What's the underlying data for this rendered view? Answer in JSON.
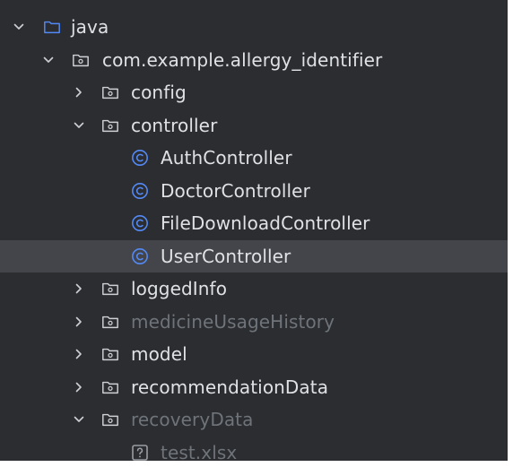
{
  "tree": {
    "items": [
      {
        "label": "java",
        "type": "source-folder",
        "state": "expanded"
      },
      {
        "label": "com.example.allergy_identifier",
        "type": "package",
        "state": "expanded"
      },
      {
        "label": "config",
        "type": "package",
        "state": "collapsed"
      },
      {
        "label": "controller",
        "type": "package",
        "state": "expanded"
      },
      {
        "label": "AuthController",
        "type": "class"
      },
      {
        "label": "DoctorController",
        "type": "class"
      },
      {
        "label": "FileDownloadController",
        "type": "class"
      },
      {
        "label": "UserController",
        "type": "class",
        "selected": true
      },
      {
        "label": "loggedInfo",
        "type": "package",
        "state": "collapsed"
      },
      {
        "label": "medicineUsageHistory",
        "type": "package",
        "state": "collapsed",
        "dimmed": true
      },
      {
        "label": "model",
        "type": "package",
        "state": "collapsed"
      },
      {
        "label": "recommendationData",
        "type": "package",
        "state": "collapsed"
      },
      {
        "label": "recoveryData",
        "type": "package",
        "state": "expanded",
        "dimmed": true
      },
      {
        "label": "test.xlsx",
        "type": "unknown-file",
        "dimmed": true
      }
    ]
  },
  "colors": {
    "background": "#2b2d30",
    "selection": "#43454a",
    "text": "#dfe1e5",
    "dimmed_text": "#6f737a",
    "class_icon": "#548af7",
    "folder_icon": "#ced0d6"
  }
}
